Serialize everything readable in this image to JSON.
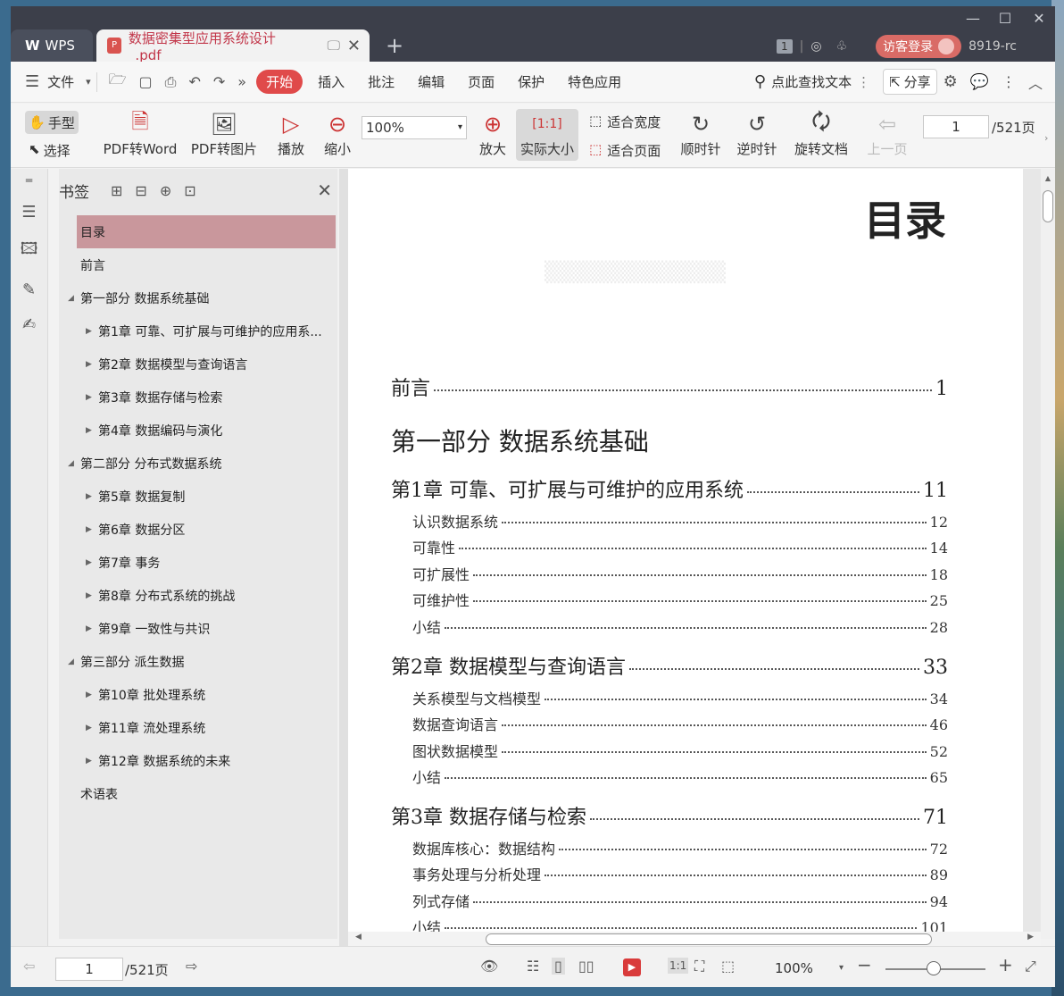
{
  "titlebar": {
    "wps_tab": "WPS",
    "doc_tab": "数据密集型应用系统设计_.pdf",
    "badge": "1",
    "login": "访客登录",
    "user_id": "8919-rc"
  },
  "menu": {
    "file": "文件",
    "items": [
      "开始",
      "插入",
      "批注",
      "编辑",
      "页面",
      "保护",
      "特色应用"
    ],
    "search": "点此查找文本",
    "share": "分享"
  },
  "toolbar": {
    "hand": "手型",
    "select": "选择",
    "pdf_to_word": "PDF转Word",
    "pdf_to_image": "PDF转图片",
    "play": "播放",
    "zoom_out": "缩小",
    "zoom_value": "100%",
    "zoom_in": "放大",
    "actual_size": "实际大小",
    "fit_width": "适合宽度",
    "fit_page": "适合页面",
    "clockwise": "顺时针",
    "counter_clockwise": "逆时针",
    "rotate_doc": "旋转文档",
    "prev_page": "上一页",
    "page_input": "1",
    "page_total": "/521页"
  },
  "bookmarks": {
    "title": "书签",
    "items": [
      {
        "label": "目录",
        "level": 0,
        "caret": ""
      },
      {
        "label": "前言",
        "level": 0,
        "caret": ""
      },
      {
        "label": "第一部分 数据系统基础",
        "level": 0,
        "caret": "◢"
      },
      {
        "label": "第1章 可靠、可扩展与可维护的应用系...",
        "level": 1,
        "caret": "▶"
      },
      {
        "label": "第2章 数据模型与查询语言",
        "level": 1,
        "caret": "▶"
      },
      {
        "label": "第3章 数据存储与检索",
        "level": 1,
        "caret": "▶"
      },
      {
        "label": "第4章 数据编码与演化",
        "level": 1,
        "caret": "▶"
      },
      {
        "label": "第二部分 分布式数据系统",
        "level": 0,
        "caret": "◢"
      },
      {
        "label": "第5章 数据复制",
        "level": 1,
        "caret": "▶"
      },
      {
        "label": "第6章 数据分区",
        "level": 1,
        "caret": "▶"
      },
      {
        "label": "第7章 事务",
        "level": 1,
        "caret": "▶"
      },
      {
        "label": "第8章 分布式系统的挑战",
        "level": 1,
        "caret": "▶"
      },
      {
        "label": "第9章 一致性与共识",
        "level": 1,
        "caret": "▶"
      },
      {
        "label": "第三部分 派生数据",
        "level": 0,
        "caret": "◢"
      },
      {
        "label": "第10章 批处理系统",
        "level": 1,
        "caret": "▶"
      },
      {
        "label": "第11章 流处理系统",
        "level": 1,
        "caret": "▶"
      },
      {
        "label": "第12章 数据系统的未来",
        "level": 1,
        "caret": "▶"
      },
      {
        "label": "术语表",
        "level": 0,
        "caret": ""
      }
    ]
  },
  "page": {
    "title": "目录",
    "preface": {
      "label": "前言",
      "page": "1"
    },
    "part1": "第一部分 数据系统基础",
    "ch1": {
      "label": "第1章 可靠、可扩展与可维护的应用系统",
      "page": "11"
    },
    "ch1_sections": [
      {
        "label": "认识数据系统",
        "page": "12"
      },
      {
        "label": "可靠性",
        "page": "14"
      },
      {
        "label": "可扩展性",
        "page": "18"
      },
      {
        "label": "可维护性",
        "page": "25"
      },
      {
        "label": "小结",
        "page": "28"
      }
    ],
    "ch2": {
      "label": "第2章 数据模型与查询语言",
      "page": "33"
    },
    "ch2_sections": [
      {
        "label": "关系模型与文档模型",
        "page": "34"
      },
      {
        "label": "数据查询语言",
        "page": "46"
      },
      {
        "label": "图状数据模型",
        "page": "52"
      },
      {
        "label": "小结",
        "page": "65"
      }
    ],
    "ch3": {
      "label": "第3章 数据存储与检索",
      "page": "71"
    },
    "ch3_sections": [
      {
        "label": "数据库核心：数据结构",
        "page": "72"
      },
      {
        "label": "事务处理与分析处理",
        "page": "89"
      },
      {
        "label": "列式存储",
        "page": "94"
      },
      {
        "label": "小结",
        "page": "101"
      }
    ]
  },
  "status": {
    "page_input": "1",
    "page_total": "/521页",
    "zoom": "100%"
  }
}
